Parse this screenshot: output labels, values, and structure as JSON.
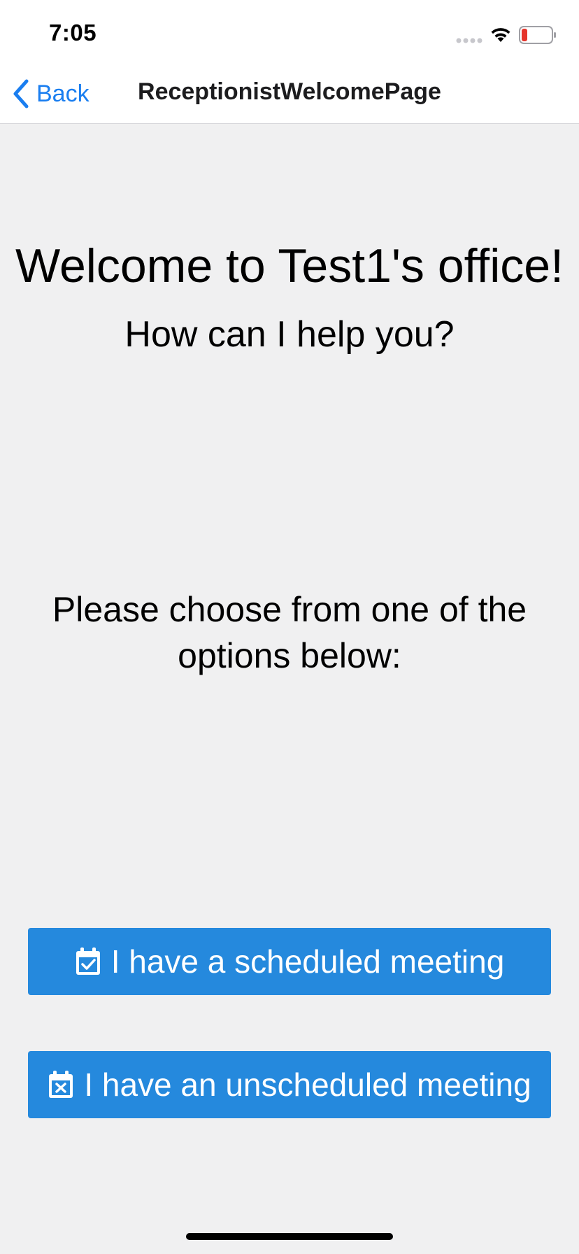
{
  "status_bar": {
    "time": "7:05",
    "battery_color": "#e5342b"
  },
  "nav": {
    "back_label": "Back",
    "title": "ReceptionistWelcomePage",
    "accent_color": "#1a7ef0"
  },
  "main": {
    "welcome_title": "Welcome to Test1's office!",
    "subtitle": "How can I help you?",
    "instructions": "Please choose from one of the options below:",
    "options": [
      {
        "label": "I have a scheduled meeting",
        "icon": "calendar-check-icon"
      },
      {
        "label": "I have an unscheduled meeting",
        "icon": "calendar-x-icon"
      }
    ],
    "button_color": "#2589dd"
  }
}
